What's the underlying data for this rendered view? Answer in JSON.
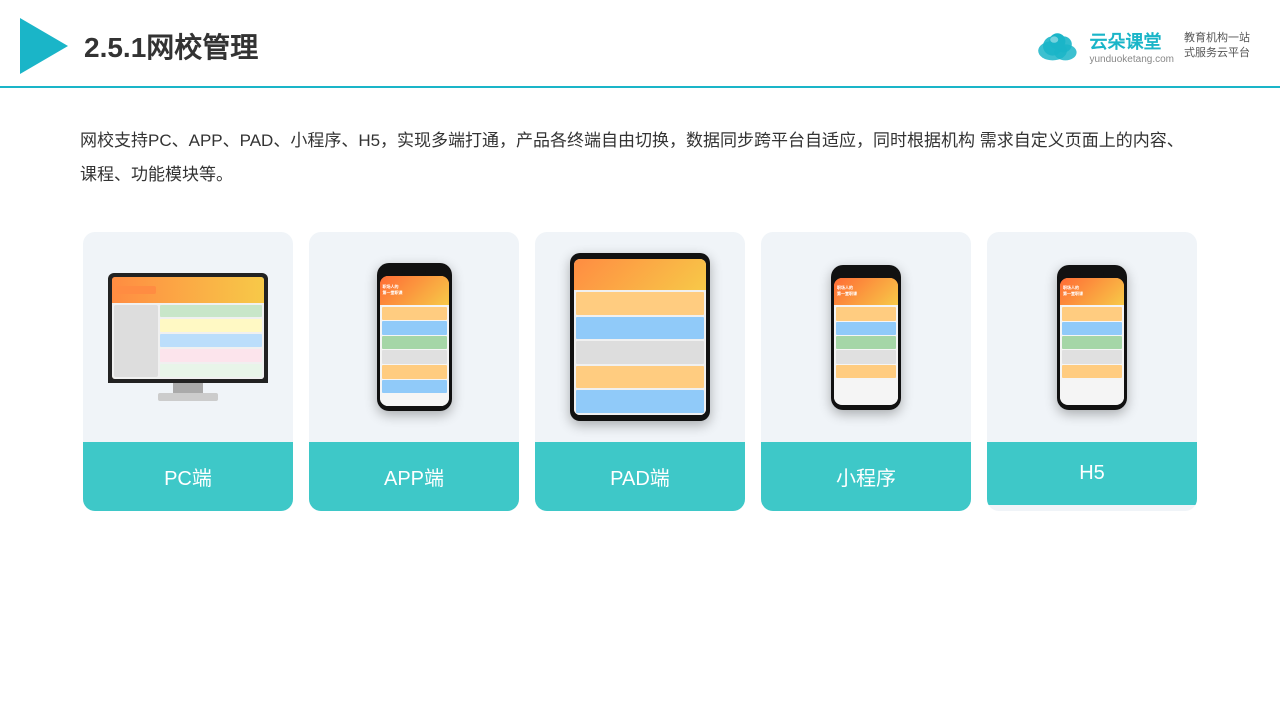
{
  "header": {
    "title": "2.5.1网校管理",
    "brand": {
      "name": "云朵课堂",
      "url": "yunduoketang.com",
      "slogan": "教育机构一站\n式服务云平台"
    }
  },
  "description": "网校支持PC、APP、PAD、小程序、H5，实现多端打通，产品各终端自由切换，数据同步跨平台自适应，同时根据机构\n需求自定义页面上的内容、课程、功能模块等。",
  "cards": [
    {
      "id": "pc",
      "label": "PC端"
    },
    {
      "id": "app",
      "label": "APP端"
    },
    {
      "id": "pad",
      "label": "PAD端"
    },
    {
      "id": "miniprogram",
      "label": "小程序"
    },
    {
      "id": "h5",
      "label": "H5"
    }
  ],
  "accent_color": "#3ec8c8"
}
